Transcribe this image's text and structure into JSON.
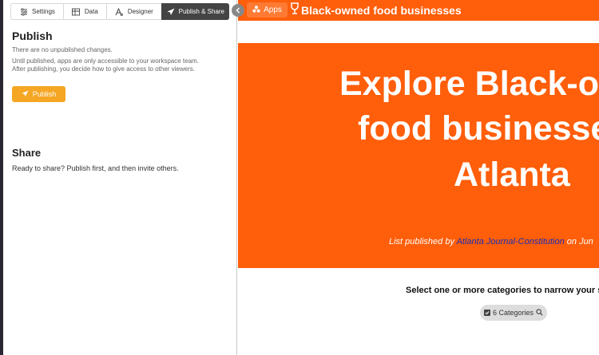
{
  "editor": {
    "tabs": [
      {
        "label": "Settings",
        "icon": "sliders-icon"
      },
      {
        "label": "Data",
        "icon": "table-icon"
      },
      {
        "label": "Designer",
        "icon": "designer-icon"
      },
      {
        "label": "Publish & Share",
        "icon": "paper-plane-icon",
        "active": true
      }
    ],
    "publish": {
      "title": "Publish",
      "status": "There are no unpublished changes.",
      "desc_line1": "Until published, apps are only accessible to your workspace team.",
      "desc_line2": "After publishing, you decide how to give access to other viewers.",
      "button_label": "Publish",
      "button_color": "#f5a623"
    },
    "share": {
      "title": "Share",
      "desc": "Ready to share? Publish first, and then invite others."
    }
  },
  "preview": {
    "apps_label": "Apps",
    "app_title": "Black-owned food businesses",
    "accent_color": "#ff5e0a",
    "hero": {
      "line1": "Explore Black-o",
      "line2": "food businesse",
      "line3": "Atlanta",
      "credit_prefix": "List published by ",
      "credit_link": "Atlanta Journal-Constitution",
      "credit_suffix": " on Jun"
    },
    "filter_prompt": "Select one or more categories to narrow your se",
    "categories_label": "6 Categories"
  }
}
